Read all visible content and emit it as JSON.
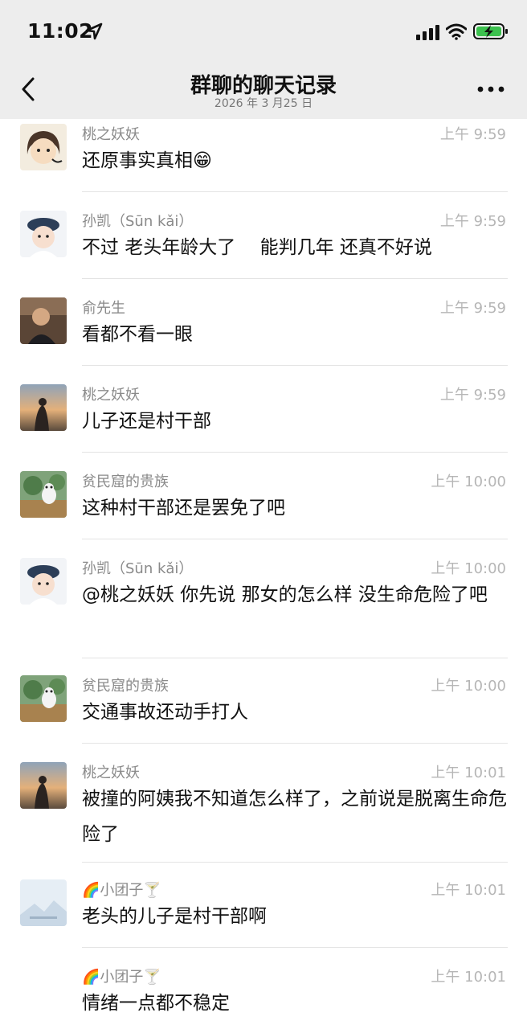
{
  "status_bar": {
    "time": "11:02"
  },
  "nav": {
    "title": "群聊的聊天记录",
    "subtitle": "2026 年 3 月25 日"
  },
  "messages": [
    {
      "sender": "桃之妖妖",
      "time": "上午 9:59",
      "text": "还原事实真相😁"
    },
    {
      "sender": "孙凯（Sūn kǎi）",
      "time": "上午 9:59",
      "text": "不过 老头年龄大了　 能判几年 还真不好说"
    },
    {
      "sender": "俞先生",
      "time": "上午 9:59",
      "text": "看都不看一眼"
    },
    {
      "sender": "桃之妖妖",
      "time": "上午 9:59",
      "text": "儿子还是村干部"
    },
    {
      "sender": "贫民窟的贵族",
      "time": "上午 10:00",
      "text": "这种村干部还是罢免了吧"
    },
    {
      "sender": "孙凯（Sūn kǎi）",
      "time": "上午 10:00",
      "text": "@桃之妖妖 你先说 那女的怎么样 没生命危险了吧"
    },
    {
      "sender": "贫民窟的贵族",
      "time": "上午 10:00",
      "text": "交通事故还动手打人"
    },
    {
      "sender": "桃之妖妖",
      "time": "上午 10:01",
      "text": "被撞的阿姨我不知道怎么样了，之前说是脱离生命危险了"
    },
    {
      "sender": "🌈小团子🍸",
      "time": "上午 10:01",
      "text": "老头的儿子是村干部啊"
    },
    {
      "sender": "🌈小团子🍸",
      "time": "上午 10:01",
      "text": "情绪一点都不稳定"
    }
  ]
}
